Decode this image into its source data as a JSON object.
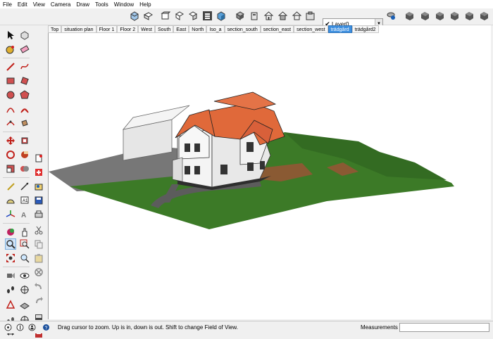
{
  "menu": [
    "File",
    "Edit",
    "View",
    "Camera",
    "Draw",
    "Tools",
    "Window",
    "Help"
  ],
  "layer": {
    "name": "Layer0",
    "check": "✔",
    "dropdown": "▼"
  },
  "scene_tabs": [
    {
      "label": "Top",
      "active": false
    },
    {
      "label": "situation plan",
      "active": false
    },
    {
      "label": "Floor 1",
      "active": false
    },
    {
      "label": "Floor 2",
      "active": false
    },
    {
      "label": "West",
      "active": false
    },
    {
      "label": "South",
      "active": false
    },
    {
      "label": "East",
      "active": false
    },
    {
      "label": "North",
      "active": false
    },
    {
      "label": "Iso_a",
      "active": false
    },
    {
      "label": "section_south",
      "active": false
    },
    {
      "label": "section_east",
      "active": false
    },
    {
      "label": "section_west",
      "active": false
    },
    {
      "label": "trädgård",
      "active": true
    },
    {
      "label": "trädgård2",
      "active": false
    }
  ],
  "status": {
    "message": "Drag cursor to zoom.  Up is in, down is out. Shift to change Field of View.",
    "measurements_label": "Measurements",
    "measurements_value": ""
  },
  "colors": {
    "roof": "#e0693a",
    "lawn": "#3c7a27",
    "path": "#5c5c5c",
    "active_tab": "#3d8fe0"
  }
}
